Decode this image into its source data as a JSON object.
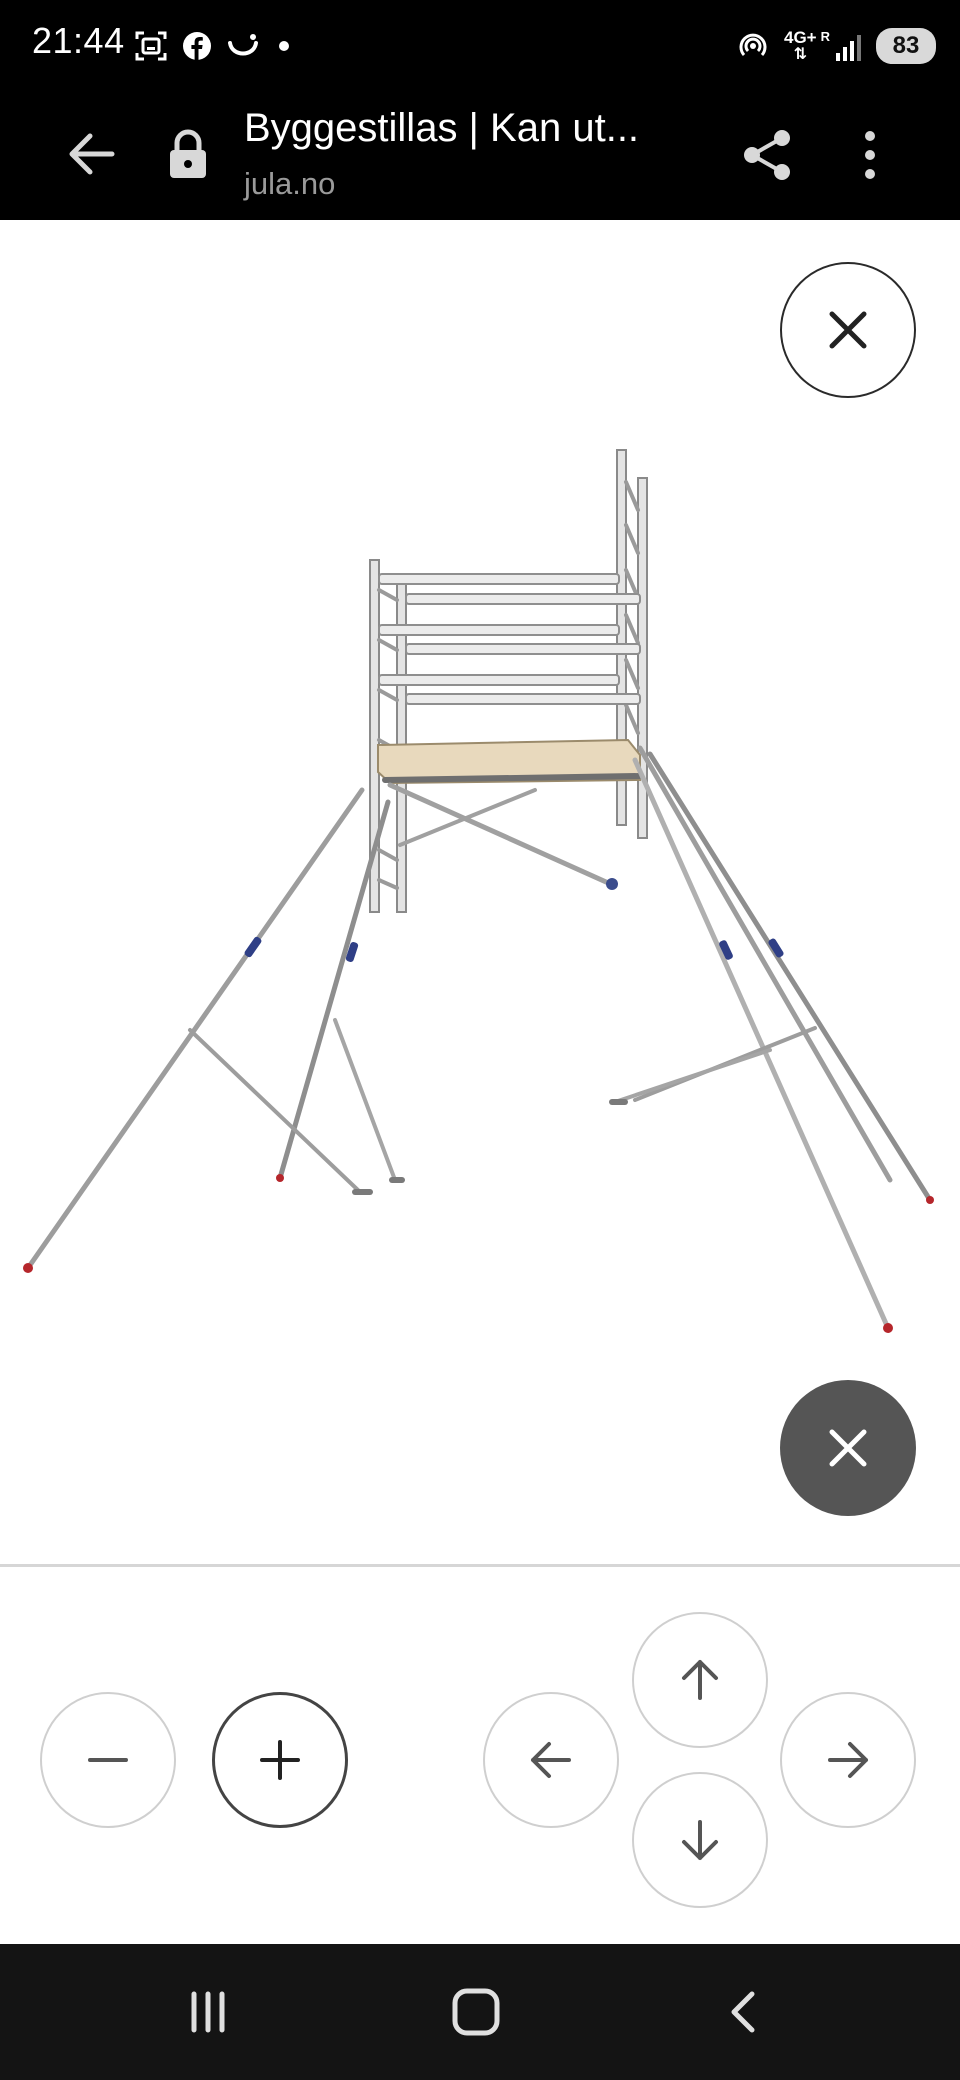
{
  "status_bar": {
    "time": "21:44",
    "network_label": "4G+",
    "network_sub": "R",
    "battery": "83",
    "icons_left": [
      "screenshot-icon",
      "facebook-icon",
      "smile-icon",
      "dot-icon"
    ],
    "icons_right": [
      "hotspot-icon",
      "signal-icon",
      "battery-icon"
    ]
  },
  "url_bar": {
    "title": "Byggestillas | Kan ut...",
    "domain": "jula.no",
    "icons": [
      "back-arrow-icon",
      "lock-icon",
      "share-icon",
      "more-vert-icon"
    ]
  },
  "viewer": {
    "image_name": "scaffold-product-image",
    "close_buttons": [
      "close-icon",
      "close-icon"
    ]
  },
  "controls": {
    "zoom": [
      "minus-icon",
      "plus-icon"
    ],
    "pan": [
      "arrow-up-icon",
      "arrow-left-icon",
      "arrow-right-icon",
      "arrow-down-icon"
    ]
  },
  "nav_bar": {
    "icons": [
      "recents-icon",
      "home-icon",
      "back-icon"
    ]
  },
  "colors": {
    "bar_bg": "#000000",
    "domain_text": "#9a9a9a",
    "dark_close": "#555555",
    "nav_bg": "#141414",
    "plank": "#e8d9bd"
  }
}
